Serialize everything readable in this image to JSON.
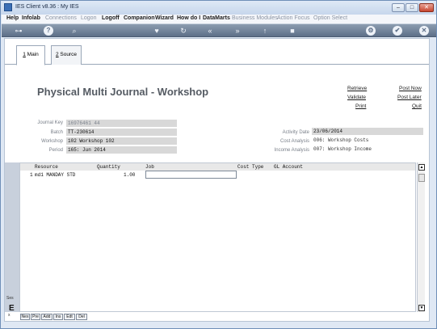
{
  "window": {
    "title": "IES Client v8.36 : My IES",
    "min": "–",
    "max": "□",
    "close": "✕"
  },
  "menu": [
    "Help",
    "Infolab",
    "Connections",
    "Logon",
    "Logoff",
    "Companion",
    "Wizard",
    "How do I",
    "DataMarts",
    "Business Modules",
    "Action Focus",
    "Option Select"
  ],
  "toolbar": {
    "icons": [
      "key-icon",
      "help-icon",
      "search-icon",
      "heart-icon",
      "refresh-icon",
      "back-icon",
      "forward-icon",
      "up-icon",
      "stop-icon",
      "settings-icon",
      "check-icon",
      "close-icon"
    ],
    "glyph_help": "?",
    "glyph_search": "⌕",
    "glyph_heart": "♥",
    "glyph_refresh": "↻",
    "glyph_back": "«",
    "glyph_fwd": "»",
    "glyph_up": "↑",
    "glyph_stop": "■",
    "glyph_settings": "⚙",
    "glyph_check": "✔",
    "glyph_close": "✕",
    "glyph_key": "⊶"
  },
  "tabs": {
    "main_accel": "1",
    "main_label": " Main",
    "source_accel": "2",
    "source_label": " Source"
  },
  "page": {
    "title": "Physical Multi Journal - Workshop"
  },
  "actions": {
    "retrieve": "Retrieve",
    "validate": "Validate",
    "print": "Print",
    "post_now": "Post Now",
    "post_later": "Post Later",
    "quit": "Quit"
  },
  "fields": {
    "journal_key_label": "Journal Key",
    "journal_key": "16976461 44",
    "batch_label": "Batch",
    "batch": "TT-230614",
    "workshop_label": "Workshop",
    "workshop": "102 Workshop 102",
    "period_label": "Period",
    "period": "165: Jun 2014",
    "activity_date_label": "Activity Date",
    "activity_date": "23/06/2014",
    "cost_analysis_label": "Cost Analysis",
    "cost_analysis": "006: Workshop Costs",
    "income_analysis_label": "Income Analysis",
    "income_analysis": "007: Workshop Income"
  },
  "grid": {
    "headers": {
      "resource": "Resource",
      "quantity": "Quantity",
      "job": "Job",
      "cost_type": "Cost Type",
      "gl_account": "GL Account"
    },
    "rows": [
      {
        "num": "1",
        "resource": "md1 MANDAY STD",
        "quantity": "1.00"
      }
    ]
  },
  "bottom_buttons": [
    "Nex",
    "Pre",
    "Add",
    "Ins",
    "Edt",
    "Del"
  ],
  "side": {
    "se": "Ses",
    "e": "E",
    "x": "x"
  }
}
